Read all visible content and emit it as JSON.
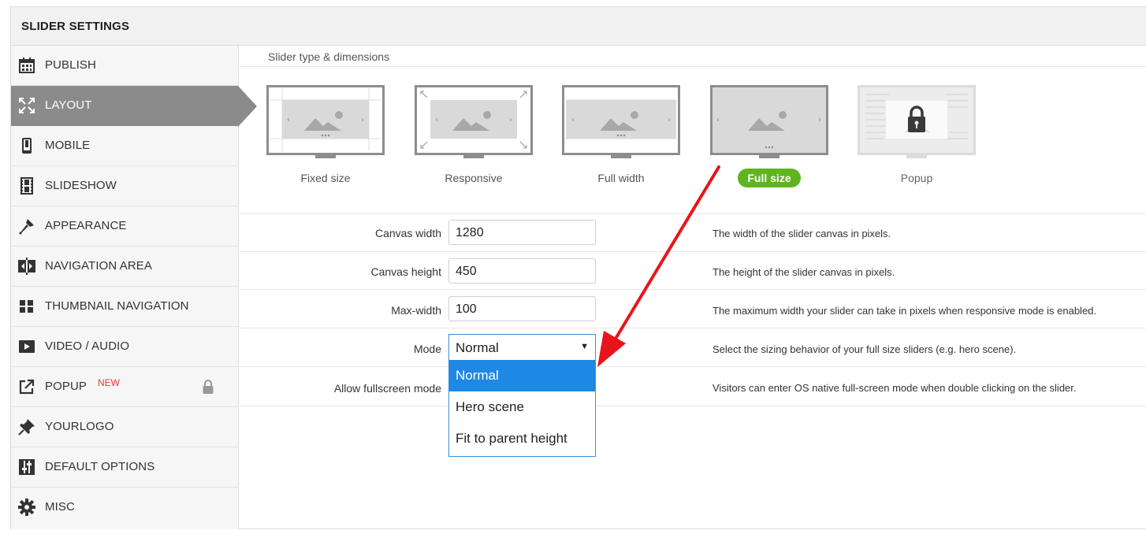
{
  "panel": {
    "title": "SLIDER SETTINGS"
  },
  "sidebar": {
    "items": [
      {
        "label": "PUBLISH",
        "icon": "calendar-icon"
      },
      {
        "label": "LAYOUT",
        "icon": "expand-icon",
        "active": true
      },
      {
        "label": "MOBILE",
        "icon": "mobile-icon"
      },
      {
        "label": "SLIDESHOW",
        "icon": "film-icon"
      },
      {
        "label": "APPEARANCE",
        "icon": "brush-icon"
      },
      {
        "label": "NAVIGATION AREA",
        "icon": "arrows-icon"
      },
      {
        "label": "THUMBNAIL NAVIGATION",
        "icon": "grid-icon"
      },
      {
        "label": "VIDEO / AUDIO",
        "icon": "play-icon"
      },
      {
        "label": "POPUP",
        "icon": "external-link-icon",
        "badge": "NEW",
        "locked": true
      },
      {
        "label": "YOURLOGO",
        "icon": "pin-icon"
      },
      {
        "label": "DEFAULT OPTIONS",
        "icon": "sliders-icon"
      },
      {
        "label": "MISC",
        "icon": "gear-icon"
      }
    ]
  },
  "main": {
    "section_label": "Slider type & dimensions",
    "slider_types": [
      {
        "label": "Fixed size"
      },
      {
        "label": "Responsive"
      },
      {
        "label": "Full width"
      },
      {
        "label": "Full size",
        "selected": true
      },
      {
        "label": "Popup",
        "locked": true
      }
    ],
    "fields": {
      "canvas_width": {
        "label": "Canvas width",
        "value": "1280",
        "description": "The width of the slider canvas in pixels."
      },
      "canvas_height": {
        "label": "Canvas height",
        "value": "450",
        "description": "The height of the slider canvas in pixels."
      },
      "max_width": {
        "label": "Max-width",
        "value": "100",
        "description": "The maximum width your slider can take in pixels when responsive mode is enabled."
      },
      "mode": {
        "label": "Mode",
        "value": "Normal",
        "description": "Select the sizing behavior of your full size sliders (e.g. hero scene).",
        "options": [
          "Normal",
          "Hero scene",
          "Fit to parent height"
        ]
      },
      "fullscreen": {
        "label": "Allow fullscreen mode",
        "description": "Visitors can enter OS native full-screen mode when double clicking on the slider."
      }
    }
  },
  "colors": {
    "active_bg": "#8b8b8b",
    "selected_badge": "#5fb41f",
    "dropdown_highlight": "#1e88e5",
    "annotation_arrow": "#e8141c",
    "new_badge": "#e53935"
  }
}
